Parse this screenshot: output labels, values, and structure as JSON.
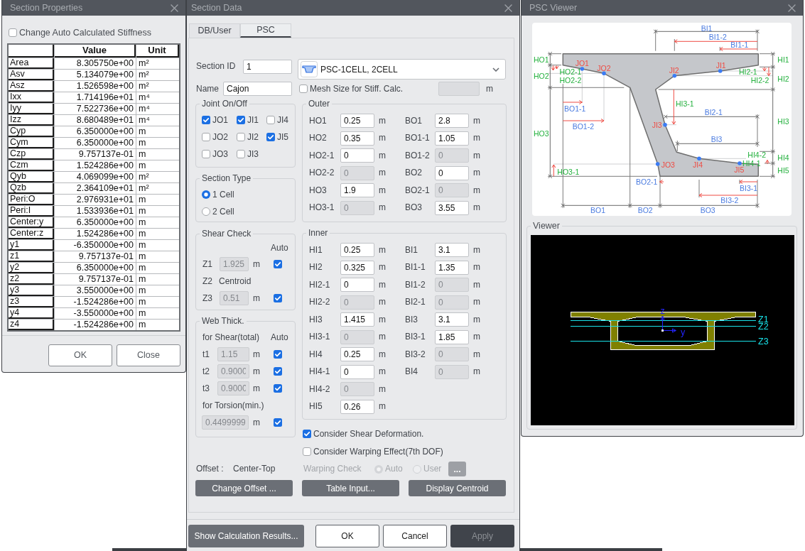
{
  "section_properties": {
    "title": "Section Properties",
    "stiffness_option": {
      "label": "Change Auto Calculated Stiffness",
      "checked": false
    },
    "table": {
      "columns": [
        "Value",
        "Unit"
      ],
      "rows": [
        {
          "name": "Area",
          "value": "8.305750e+00",
          "unit": "m²"
        },
        {
          "name": "Asv",
          "value": "5.134079e+00",
          "unit": "m²"
        },
        {
          "name": "Asz",
          "value": "1.526598e+00",
          "unit": "m²"
        },
        {
          "name": "Ixx",
          "value": "1.714196e+01",
          "unit": "m⁴"
        },
        {
          "name": "Iyy",
          "value": "7.522736e+00",
          "unit": "m⁴"
        },
        {
          "name": "Izz",
          "value": "8.680489e+01",
          "unit": "m⁴"
        },
        {
          "name": "Cyp",
          "value": "6.350000e+00",
          "unit": "m"
        },
        {
          "name": "Cym",
          "value": "6.350000e+00",
          "unit": "m"
        },
        {
          "name": "Czp",
          "value": "9.757137e-01",
          "unit": "m"
        },
        {
          "name": "Czm",
          "value": "1.524286e+00",
          "unit": "m"
        },
        {
          "name": "Qyb",
          "value": "4.069099e+00",
          "unit": "m²"
        },
        {
          "name": "Qzb",
          "value": "2.364109e+01",
          "unit": "m²"
        },
        {
          "name": "Peri:O",
          "value": "2.976931e+01",
          "unit": "m"
        },
        {
          "name": "Peri:I",
          "value": "1.533936e+01",
          "unit": "m"
        },
        {
          "name": "Center:y",
          "value": "6.350000e+00",
          "unit": "m"
        },
        {
          "name": "Center:z",
          "value": "1.524286e+00",
          "unit": "m"
        },
        {
          "name": "y1",
          "value": "-6.350000e+00",
          "unit": "m"
        },
        {
          "name": "z1",
          "value": "9.757137e-01",
          "unit": "m"
        },
        {
          "name": "y2",
          "value": "6.350000e+00",
          "unit": "m"
        },
        {
          "name": "z2",
          "value": "9.757137e-01",
          "unit": "m"
        },
        {
          "name": "y3",
          "value": "3.550000e+00",
          "unit": "m"
        },
        {
          "name": "z3",
          "value": "-1.524286e+00",
          "unit": "m"
        },
        {
          "name": "y4",
          "value": "-3.550000e+00",
          "unit": "m"
        },
        {
          "name": "z4",
          "value": "-1.524286e+00",
          "unit": "m"
        }
      ]
    },
    "buttons": [
      "OK",
      "Close"
    ]
  },
  "section_data": {
    "title": "Section Data",
    "tabs": [
      {
        "label": "DB/User",
        "selected": false
      },
      {
        "label": "PSC",
        "selected": true
      }
    ],
    "section_id": {
      "label": "Section ID",
      "value": "1"
    },
    "shape_dropdown": {
      "value": "PSC-1CELL, 2CELL"
    },
    "name": {
      "label": "Name",
      "value": "Cajon"
    },
    "mesh_size": {
      "label": "Mesh Size for Stiff. Calc.",
      "checked": false,
      "field_disabled": true,
      "unit": "m"
    },
    "joint_group": {
      "title": "Joint On/Off",
      "joints": [
        {
          "label": "JO1",
          "checked": true
        },
        {
          "label": "JI1",
          "checked": true
        },
        {
          "label": "JI4",
          "checked": false
        },
        {
          "label": "JO2",
          "checked": false
        },
        {
          "label": "JI2",
          "checked": false
        },
        {
          "label": "JI5",
          "checked": true
        },
        {
          "label": "JO3",
          "checked": false
        },
        {
          "label": "JI3",
          "checked": false
        }
      ]
    },
    "section_type": {
      "title": "Section Type",
      "options": [
        {
          "label": "1 Cell",
          "selected": true
        },
        {
          "label": "2 Cell",
          "selected": false
        }
      ]
    },
    "shear_check": {
      "title": "Shear Check",
      "auto_header": "Auto",
      "rows": [
        {
          "kind": "field",
          "label": "Z1",
          "value": "1.925",
          "disabled": true,
          "unit": "m",
          "auto": true
        },
        {
          "kind": "text",
          "label": "Z2",
          "value": "Centroid"
        },
        {
          "kind": "field",
          "label": "Z3",
          "value": "0.51",
          "disabled": true,
          "unit": "m",
          "auto": true
        }
      ]
    },
    "web_thick": {
      "title": "Web Thick.",
      "shear_header": "for Shear(total)",
      "auto_header": "Auto",
      "rows": [
        {
          "label": "t1",
          "value": "1.15",
          "disabled": true,
          "unit": "m",
          "auto": true
        },
        {
          "label": "t2",
          "value": "0.9000",
          "disabled": true,
          "unit": "m",
          "auto": true
        },
        {
          "label": "t3",
          "value": "0.9000",
          "disabled": true,
          "unit": "m",
          "auto": true
        }
      ],
      "torsion_header": "for Torsion(min.)",
      "torsion": {
        "value": "0.4499999",
        "disabled": true,
        "unit": "m",
        "auto": true
      }
    },
    "outer": {
      "title": "Outer",
      "left": [
        {
          "label": "HO1",
          "value": "0.25",
          "unit": "m",
          "disabled": false
        },
        {
          "label": "HO2",
          "value": "0.35",
          "unit": "m",
          "disabled": false
        },
        {
          "label": "HO2-1",
          "value": "0",
          "unit": "m",
          "disabled": false
        },
        {
          "label": "HO2-2",
          "value": "0",
          "unit": "m",
          "disabled": true
        },
        {
          "label": "HO3",
          "value": "1.9",
          "unit": "m",
          "disabled": false
        },
        {
          "label": "HO3-1",
          "value": "0",
          "unit": "m",
          "disabled": true
        }
      ],
      "right": [
        {
          "label": "BO1",
          "value": "2.8",
          "unit": "m",
          "disabled": false
        },
        {
          "label": "BO1-1",
          "value": "1.05",
          "unit": "m",
          "disabled": false
        },
        {
          "label": "BO1-2",
          "value": "0",
          "unit": "m",
          "disabled": true
        },
        {
          "label": "BO2",
          "value": "0",
          "unit": "m",
          "disabled": false
        },
        {
          "label": "BO2-1",
          "value": "0",
          "unit": "m",
          "disabled": true
        },
        {
          "label": "BO3",
          "value": "3.55",
          "unit": "m",
          "disabled": false
        }
      ]
    },
    "inner": {
      "title": "Inner",
      "left": [
        {
          "label": "HI1",
          "value": "0.25",
          "unit": "m",
          "disabled": false
        },
        {
          "label": "HI2",
          "value": "0.325",
          "unit": "m",
          "disabled": false
        },
        {
          "label": "HI2-1",
          "value": "0",
          "unit": "m",
          "disabled": false
        },
        {
          "label": "HI2-2",
          "value": "0",
          "unit": "m",
          "disabled": true
        },
        {
          "label": "HI3",
          "value": "1.415",
          "unit": "m",
          "disabled": false
        },
        {
          "label": "HI3-1",
          "value": "0",
          "unit": "m",
          "disabled": true
        },
        {
          "label": "HI4",
          "value": "0.25",
          "unit": "m",
          "disabled": false
        },
        {
          "label": "HI4-1",
          "value": "0",
          "unit": "m",
          "disabled": false
        },
        {
          "label": "HI4-2",
          "value": "0",
          "unit": "m",
          "disabled": true
        },
        {
          "label": "HI5",
          "value": "0.26",
          "unit": "m",
          "disabled": false
        }
      ],
      "right": [
        {
          "label": "BI1",
          "value": "3.1",
          "unit": "m",
          "disabled": false
        },
        {
          "label": "BI1-1",
          "value": "1.35",
          "unit": "m",
          "disabled": false
        },
        {
          "label": "BI1-2",
          "value": "0",
          "unit": "m",
          "disabled": true
        },
        {
          "label": "BI2-1",
          "value": "0",
          "unit": "m",
          "disabled": true
        },
        {
          "label": "BI3",
          "value": "3.1",
          "unit": "m",
          "disabled": false
        },
        {
          "label": "BI3-1",
          "value": "1.85",
          "unit": "m",
          "disabled": false
        },
        {
          "label": "BI3-2",
          "value": "0",
          "unit": "m",
          "disabled": true
        },
        {
          "label": "BI4",
          "value": "0",
          "unit": "m",
          "disabled": true
        }
      ]
    },
    "options": [
      {
        "label": "Consider Shear Deformation.",
        "checked": true
      },
      {
        "label": "Consider Warping Effect(7th DOF)",
        "checked": false
      }
    ],
    "offset": {
      "label": "Offset :",
      "value": "Center-Top"
    },
    "warping_check": {
      "label": "Warping Check",
      "disabled": true,
      "options": [
        {
          "label": "Auto",
          "selected": true
        },
        {
          "label": "User",
          "selected": false
        }
      ],
      "button": "..."
    },
    "actions": [
      "Change Offset ...",
      "Table Input...",
      "Display Centroid"
    ],
    "footer": [
      {
        "label": "Show Calculation Results...",
        "kind": "secondary",
        "disabled": false
      },
      {
        "label": "OK",
        "kind": "plain",
        "disabled": false
      },
      {
        "label": "Cancel",
        "kind": "plain",
        "disabled": false
      },
      {
        "label": "Apply",
        "kind": "secondary",
        "disabled": true
      }
    ]
  },
  "psc_viewer": {
    "title": "PSC Viewer",
    "diagram": {
      "joint_labels": [
        "JO1",
        "JO2",
        "JO3",
        "JI1",
        "JI2",
        "JI3",
        "JI4",
        "JI5"
      ],
      "height_labels": [
        "HO1",
        "HO2",
        "HO2-1",
        "HO2-2",
        "HO3",
        "HO3-1",
        "HI1",
        "HI2",
        "HI2-1",
        "HI2-2",
        "HI3",
        "HI3-1",
        "HI4",
        "HI4-1",
        "HI4-2",
        "HI5"
      ],
      "width_labels": [
        "BO1",
        "BO1-1",
        "BO1-2",
        "BO2",
        "BO2-1",
        "BO3",
        "BI1",
        "BI1-1",
        "BI1-2",
        "BI2-1",
        "BI3",
        "BI3-1",
        "BI3-2"
      ]
    },
    "viewer": {
      "title": "Viewer",
      "axis_labels": [
        "z",
        "y"
      ],
      "level_labels": [
        "Z1",
        "Z2",
        "Z3"
      ]
    }
  }
}
